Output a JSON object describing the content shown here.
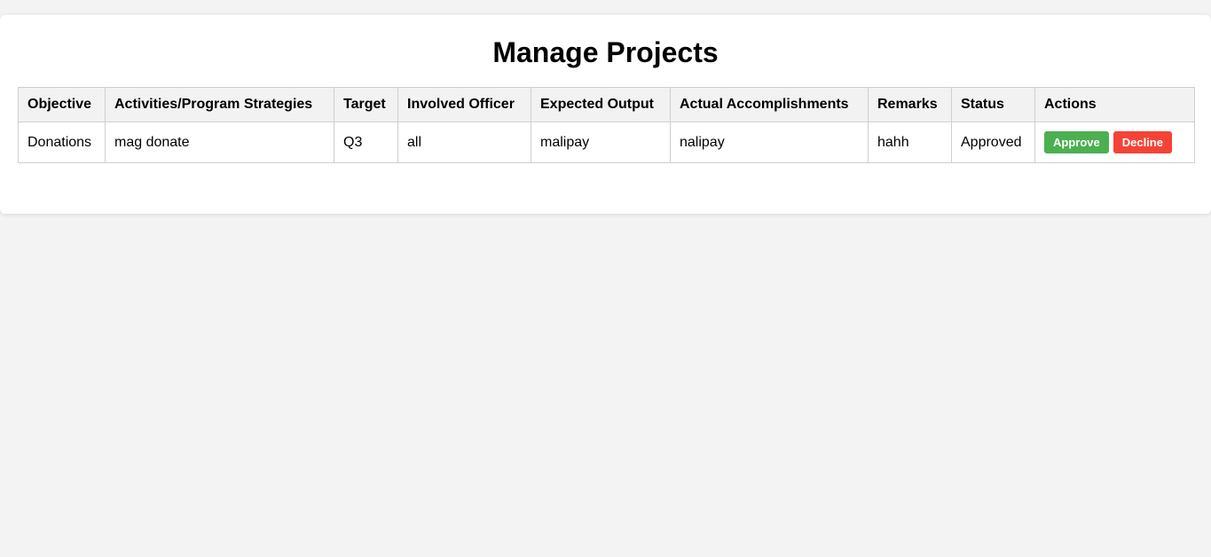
{
  "page": {
    "title": "Manage Projects"
  },
  "table": {
    "headers": {
      "objective": "Objective",
      "activities": "Activities/Program Strategies",
      "target": "Target",
      "officer": "Involved Officer",
      "expected": "Expected Output",
      "actual": "Actual Accomplishments",
      "remarks": "Remarks",
      "status": "Status",
      "actions": "Actions"
    },
    "rows": [
      {
        "objective": "Donations",
        "activities": "mag donate",
        "target": "Q3",
        "officer": "all",
        "expected": "malipay",
        "actual": "nalipay",
        "remarks": "hahh",
        "status": "Approved",
        "approve_label": "Approve",
        "decline_label": "Decline"
      }
    ]
  },
  "colors": {
    "approve": "#4caf50",
    "decline": "#f44336",
    "header_bg": "#f2f2f2",
    "page_bg": "#f3f3f3"
  }
}
